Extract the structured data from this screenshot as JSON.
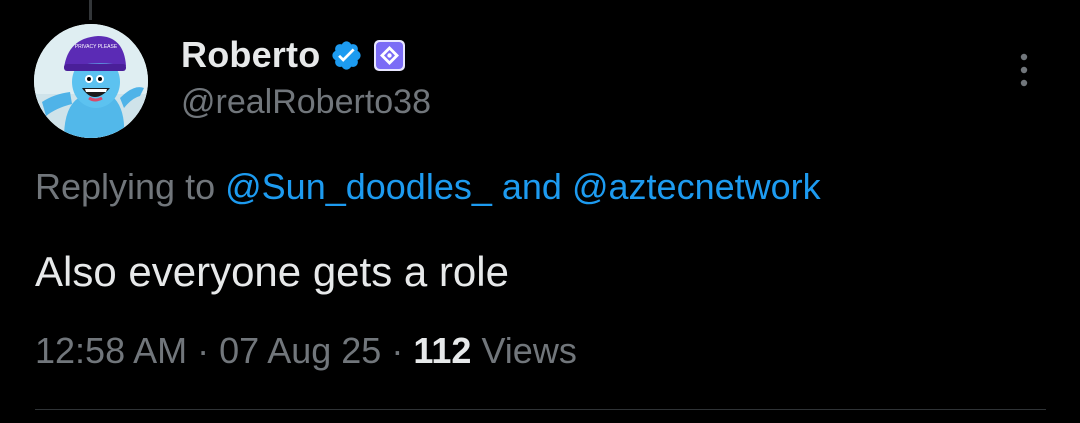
{
  "author": {
    "display_name": "Roberto",
    "handle": "@realRoberto38",
    "avatar_icon": "avatar-image"
  },
  "reply_context": {
    "prefix": "Replying to",
    "mention_1": "@Sun_doodles_",
    "connector": "and",
    "mention_2": "@aztecnetwork"
  },
  "tweet": {
    "text": "Also everyone gets a role"
  },
  "meta": {
    "time": "12:58 AM",
    "separator": "·",
    "date": "07 Aug 25",
    "views_count": "112",
    "views_label": "Views"
  },
  "colors": {
    "background": "#000000",
    "text_primary": "#e7e9ea",
    "text_secondary": "#71767b",
    "link": "#1d9bf0",
    "verified_badge": "#1d9bf0",
    "affiliate_badge": "#7b6cf6",
    "divider": "#2f3336"
  }
}
